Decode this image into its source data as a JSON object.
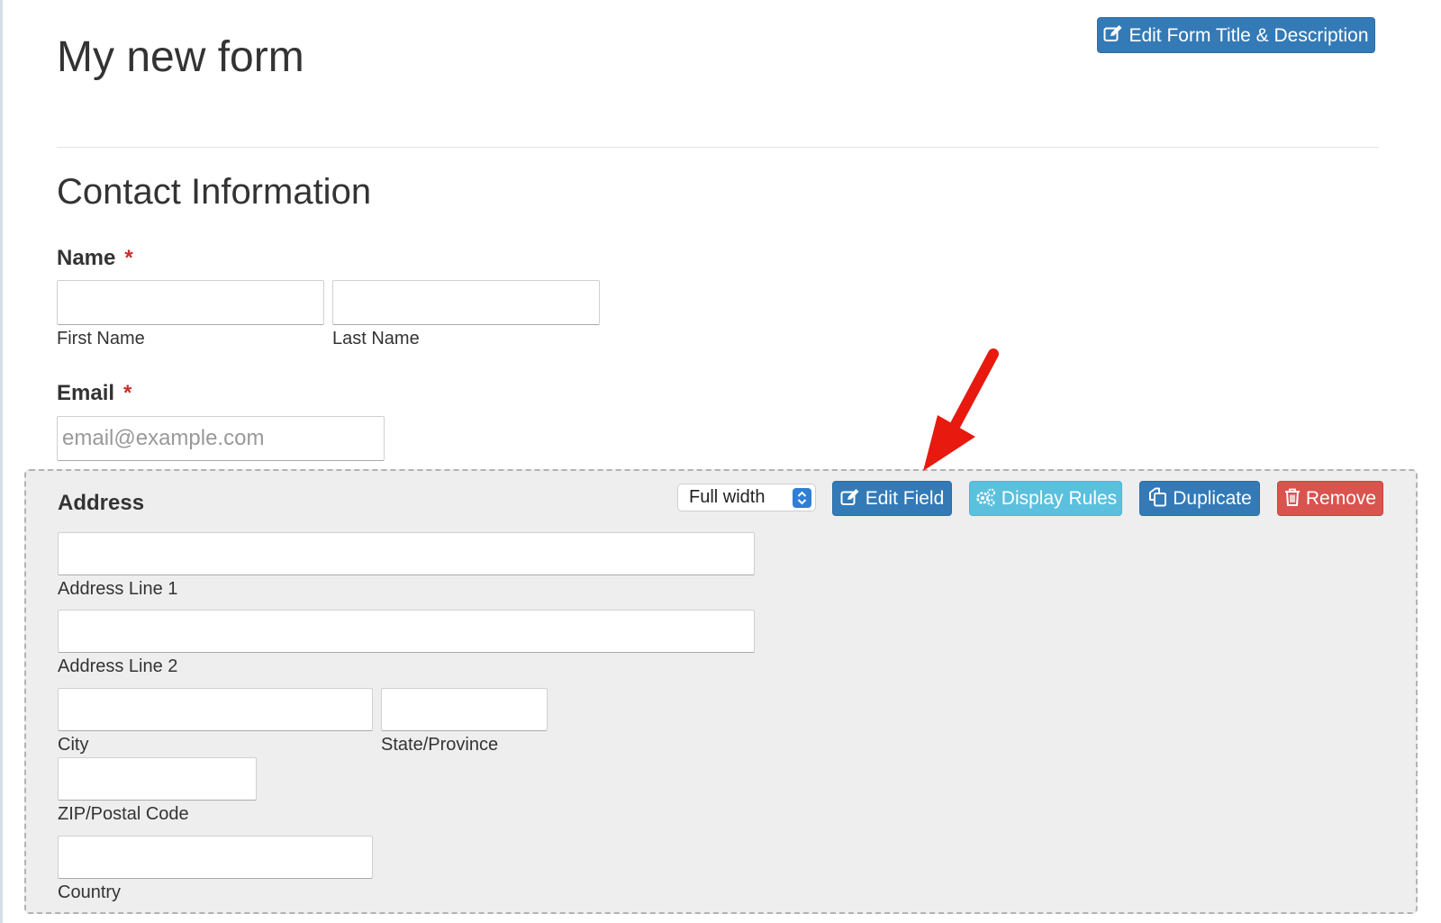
{
  "form": {
    "title": "My new form",
    "edit_title_button": "Edit Form Title & Description"
  },
  "section": {
    "heading": "Contact Information"
  },
  "name_field": {
    "label": "Name",
    "required_mark": "*",
    "first_name_label": "First Name",
    "last_name_label": "Last Name"
  },
  "email_field": {
    "label": "Email",
    "required_mark": "*",
    "placeholder": "email@example.com"
  },
  "address_field": {
    "label": "Address",
    "width_select_value": "Full width",
    "toolbar": {
      "edit_field": "Edit Field",
      "display_rules": "Display Rules",
      "duplicate": "Duplicate",
      "remove": "Remove"
    },
    "sublabels": {
      "line1": "Address Line 1",
      "line2": "Address Line 2",
      "city": "City",
      "state": "State/Province",
      "zip": "ZIP/Postal Code",
      "country": "Country"
    }
  },
  "colors": {
    "primary": "#337ab7",
    "info": "#5bc0de",
    "danger": "#d9534f",
    "annotation_arrow": "#e8190e",
    "required": "#c9302c"
  },
  "icons": {
    "edit": "edit-icon",
    "cogs": "cogs-icon",
    "duplicate": "duplicate-icon",
    "trash": "trash-icon",
    "select_arrows": "updown-chevron-icon"
  }
}
